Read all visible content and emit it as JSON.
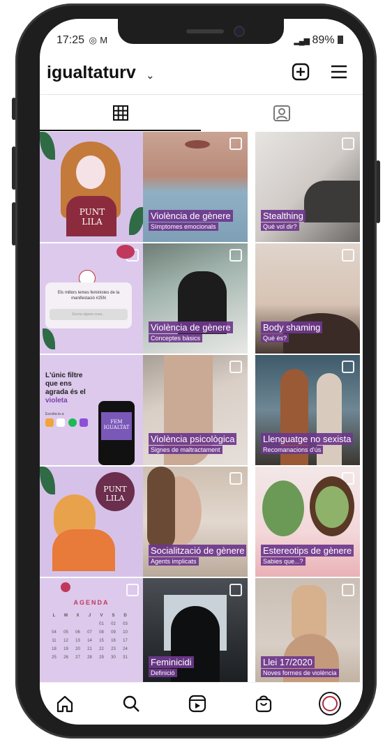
{
  "status": {
    "time": "17:25",
    "battery": "89%"
  },
  "header": {
    "username": "igualtaturv"
  },
  "icons": {
    "add": "plus-square-icon",
    "menu": "hamburger-menu-icon",
    "grid": "grid-icon",
    "tagged": "tagged-user-icon",
    "home": "home-icon",
    "search": "search-icon",
    "reels": "reels-icon",
    "shop": "shop-bag-icon",
    "profile": "profile-avatar"
  },
  "colors": {
    "accent_purple": "#6e378c",
    "lilac": "#d9c6ea"
  },
  "posts": [
    {
      "id": "p1",
      "title": "",
      "subtitle": "",
      "text": "PUNT LILA"
    },
    {
      "id": "p2",
      "title": "Violència de gènere",
      "subtitle": "Símptomes emocionals"
    },
    {
      "id": "p3",
      "title": "Stealthing",
      "subtitle": "Què vol dir?"
    },
    {
      "id": "p4",
      "title": "",
      "subtitle": "",
      "lines": [
        "Els millors lemes feministes de la",
        "manifestació #25N"
      ],
      "placeholder": "Escriu alguna cosa..."
    },
    {
      "id": "p5",
      "title": "Violència de gènere",
      "subtitle": "Conceptes bàsics"
    },
    {
      "id": "p6",
      "title": "Body shaming",
      "subtitle": "Què és?"
    },
    {
      "id": "p7",
      "title": "",
      "subtitle": "",
      "lines": [
        "L'únic filtre",
        "que ens",
        "agrada és el",
        "violeta"
      ],
      "playlist": "Escolta-la a:",
      "album": "FEM IGUALTAT"
    },
    {
      "id": "p8",
      "title": "Violència psicològica",
      "subtitle": "Signes de maltractament"
    },
    {
      "id": "p9",
      "title": "Llenguatge no sexista",
      "subtitle": "Recomanacions d'ús"
    },
    {
      "id": "p10",
      "title": "",
      "subtitle": "",
      "text": "PUNT LILA"
    },
    {
      "id": "p11",
      "title": "Socialització de gènere",
      "subtitle": "Agents implicats"
    },
    {
      "id": "p12",
      "title": "Estereotips de gènere",
      "subtitle": "Sabies que...?"
    },
    {
      "id": "p13",
      "title": "",
      "subtitle": "",
      "text": "AGENDA",
      "days": [
        "L",
        "M",
        "X",
        "J",
        "V",
        "S",
        "D"
      ],
      "dates": [
        "",
        "",
        "",
        "",
        "01",
        "02",
        "03",
        "04",
        "05",
        "06",
        "07",
        "08",
        "09",
        "10",
        "11",
        "12",
        "13",
        "14",
        "15",
        "16",
        "17",
        "18",
        "19",
        "20",
        "21",
        "22",
        "23",
        "24",
        "25",
        "26",
        "27",
        "28",
        "29",
        "30",
        "31"
      ]
    },
    {
      "id": "p14",
      "title": "Feminicidi",
      "subtitle": "Definició"
    },
    {
      "id": "p15",
      "title": "Llei 17/2020",
      "subtitle": "Noves formes de violència"
    }
  ]
}
